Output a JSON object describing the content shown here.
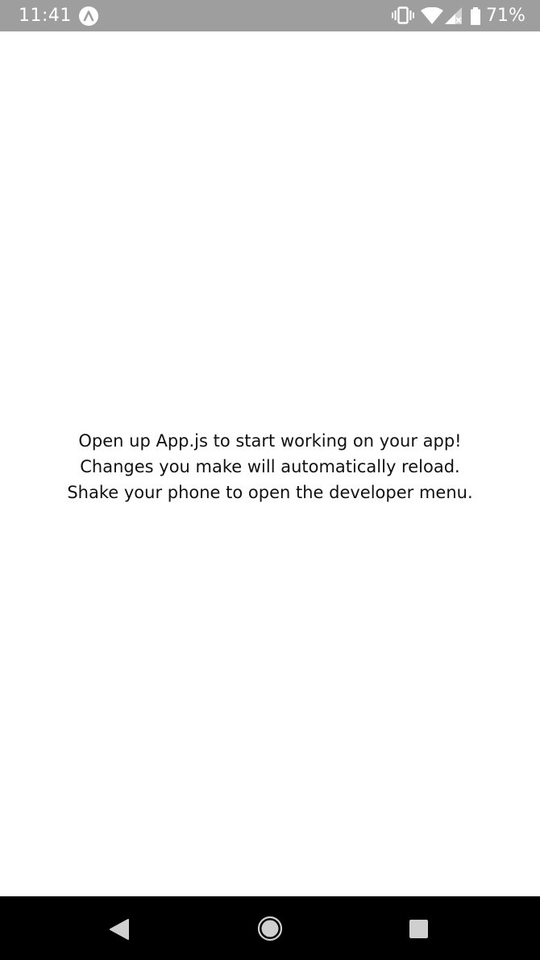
{
  "status_bar": {
    "time": "11:41",
    "battery_percent": "71%",
    "icons": [
      "expo-icon",
      "vibrate-icon",
      "wifi-icon",
      "signal-icon",
      "battery-icon"
    ],
    "background_color": "#9e9e9e"
  },
  "main": {
    "lines": [
      "Open up App.js to start working on your app!",
      "Changes you make will automatically reload.",
      "Shake your phone to open the developer menu."
    ]
  },
  "nav_bar": {
    "icons": [
      "back-icon",
      "home-icon",
      "recents-icon"
    ],
    "background_color": "#000000"
  }
}
